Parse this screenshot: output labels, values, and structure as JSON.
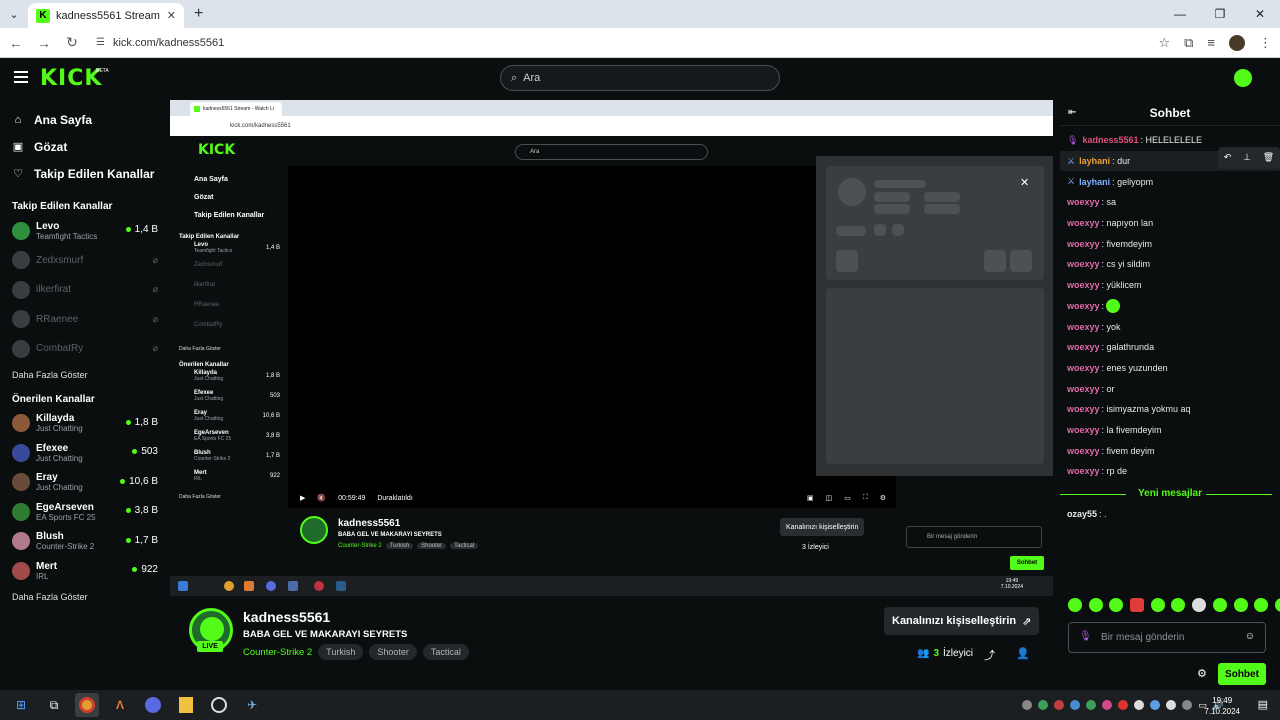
{
  "browser": {
    "tab_title": "kadness5561 Stream - Watch Li",
    "url": "kick.com/kadness5561"
  },
  "header": {
    "logo": "KICK",
    "beta": "BETA",
    "search_placeholder": "Ara"
  },
  "sidebar": {
    "nav": [
      {
        "label": "Ana Sayfa",
        "icon": "home-icon"
      },
      {
        "label": "Gözat",
        "icon": "browse-icon"
      },
      {
        "label": "Takip Edilen Kanallar",
        "icon": "heart-icon"
      }
    ],
    "followed_title": "Takip Edilen Kanallar",
    "followed": [
      {
        "name": "Levo",
        "category": "Teamfight Tactics",
        "viewers": "1,4 B",
        "live": true
      },
      {
        "name": "Zedxsmurf",
        "live": false
      },
      {
        "name": "ilkerfirat",
        "live": false
      },
      {
        "name": "RRaenee",
        "live": false
      },
      {
        "name": "CombatRy",
        "live": false
      }
    ],
    "more_label": "Daha Fazla Göster",
    "recommended_title": "Önerilen Kanallar",
    "recommended": [
      {
        "name": "Killayda",
        "category": "Just Chatting",
        "viewers": "1,8 B"
      },
      {
        "name": "Efexee",
        "category": "Just Chatting",
        "viewers": "503"
      },
      {
        "name": "Eray",
        "category": "Just Chatting",
        "viewers": "10,6 B"
      },
      {
        "name": "EgeArseven",
        "category": "EA Sports FC 25",
        "viewers": "3,8 B"
      },
      {
        "name": "Blush",
        "category": "Counter-Strike 2",
        "viewers": "1,7 B"
      },
      {
        "name": "Mert",
        "category": "IRL",
        "viewers": "922"
      }
    ],
    "more_label2": "Daha Fazla Göster"
  },
  "inner_player": {
    "time": "00:59:49",
    "status": "Duraklatıldı"
  },
  "stream": {
    "live_badge": "LIVE",
    "channel": "kadness5561",
    "title": "BABA GEL VE MAKARAYI SEYRETS",
    "category": "Counter-Strike 2",
    "tags": [
      "Turkish",
      "Shooter",
      "Tactical"
    ],
    "customize_label": "Kanalınızı kişiselleştirin",
    "viewers_count": "3",
    "viewers_label": "İzleyici"
  },
  "chat": {
    "title": "Sohbet",
    "messages": [
      {
        "user": "kadness5561",
        "text": ": HELELELELE",
        "color": "#e0507e",
        "badge": "mic"
      },
      {
        "user": "layhani",
        "text": ": dur",
        "color": "#f0a030",
        "badge": "sword",
        "highlight": true
      },
      {
        "user": "layhani",
        "text": ": geliyopm",
        "color": "#7fb3ff",
        "badge": "sword"
      },
      {
        "user": "woexyy",
        "text": ": sa",
        "color": "#e06aa8"
      },
      {
        "user": "woexyy",
        "text": ": napıyon lan",
        "color": "#e06aa8"
      },
      {
        "user": "woexyy",
        "text": ": fivemdeyim",
        "color": "#e06aa8"
      },
      {
        "user": "woexyy",
        "text": ": cs yi sildim",
        "color": "#e06aa8"
      },
      {
        "user": "woexyy",
        "text": ": yüklicem",
        "color": "#e06aa8"
      },
      {
        "user": "woexyy",
        "text": ": ",
        "color": "#e06aa8",
        "emote": true
      },
      {
        "user": "woexyy",
        "text": ": yok",
        "color": "#e06aa8"
      },
      {
        "user": "woexyy",
        "text": ": galathrunda",
        "color": "#e06aa8"
      },
      {
        "user": "woexyy",
        "text": ": enes yuzunden",
        "color": "#e06aa8"
      },
      {
        "user": "woexyy",
        "text": ": or",
        "color": "#e06aa8"
      },
      {
        "user": "woexyy",
        "text": ": isimyazma yokmu aq",
        "color": "#e06aa8"
      },
      {
        "user": "woexyy",
        "text": ": la fivemdeyim",
        "color": "#e06aa8"
      },
      {
        "user": "woexyy",
        "text": ": fivem deyim",
        "color": "#e06aa8"
      },
      {
        "user": "woexyy",
        "text": ": rp de",
        "color": "#e06aa8"
      }
    ],
    "new_messages_label": "Yeni mesajlar",
    "new_message": {
      "user": "ozay55",
      "text": ": ."
    },
    "input_placeholder": "Bir mesaj gönderin",
    "send_label": "Sohbet"
  },
  "taskbar": {
    "time": "19:49",
    "date": "7.10.2024"
  }
}
